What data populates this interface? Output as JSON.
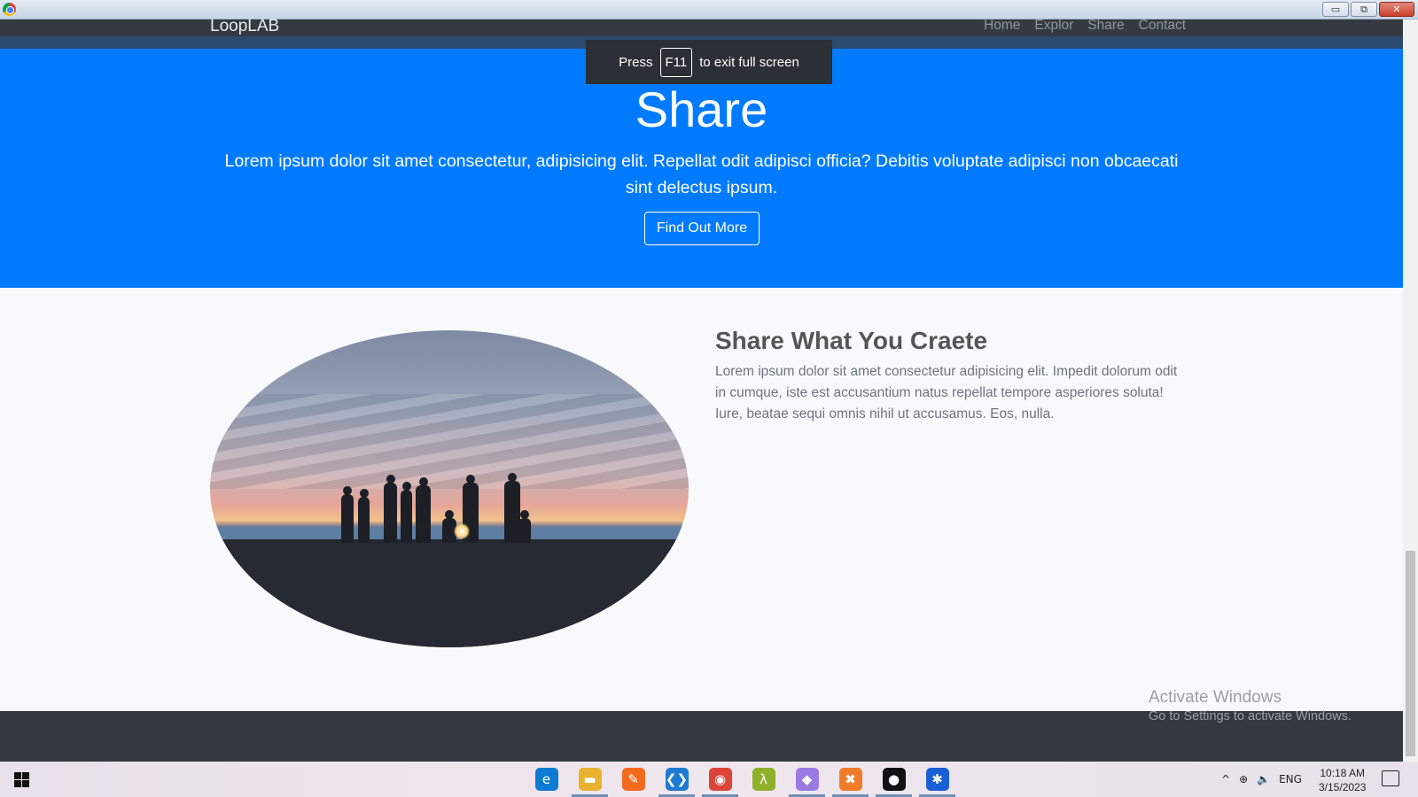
{
  "window": {
    "minimize": "▭",
    "restore": "⧉",
    "close": "✕"
  },
  "navbar": {
    "brand": "LoopLAB",
    "links": [
      "Home",
      "Explor",
      "Share",
      "Contact"
    ]
  },
  "fullscreen_notice": {
    "prefix": "Press",
    "key": "F11",
    "suffix": "to exit full screen"
  },
  "hero": {
    "title": "Share",
    "text": "Lorem ipsum dolor sit amet consectetur, adipisicing elit. Repellat odit adipisci officia? Debitis voluptate adipisci non obcaecati sint delectus ipsum.",
    "button": "Find Out More",
    "background": "#007bff"
  },
  "feature": {
    "heading": "Share What You Craete",
    "text": "Lorem ipsum dolor sit amet consectetur adipisicing elit. Impedit dolorum odit in cumque, iste est accusantium natus repellat tempore asperiores soluta! Iure, beatae sequi omnis nihil ut accusamus. Eos, nulla."
  },
  "watermark": {
    "line1": "Activate Windows",
    "line2": "Go to Settings to activate Windows."
  },
  "taskbar": {
    "apps": [
      {
        "name": "edge-icon",
        "glyph": "e",
        "color": "#0c7bd1",
        "active": false
      },
      {
        "name": "file-explorer-icon",
        "glyph": "▬",
        "color": "#e8b230",
        "active": true
      },
      {
        "name": "brush-app-icon",
        "glyph": "✎",
        "color": "#f26b1d",
        "active": false
      },
      {
        "name": "vscode-icon",
        "glyph": "❮❯",
        "color": "#1f7ad1",
        "active": true
      },
      {
        "name": "chrome-icon",
        "glyph": "◉",
        "color": "#db4437",
        "active": true
      },
      {
        "name": "lambda-app-icon",
        "glyph": "λ",
        "color": "#8fb02a",
        "active": false
      },
      {
        "name": "git-app-icon",
        "glyph": "◆",
        "color": "#9b7be3",
        "active": true
      },
      {
        "name": "xampp-icon",
        "glyph": "✖",
        "color": "#f07c2a",
        "active": true
      },
      {
        "name": "recorder-icon",
        "glyph": "●",
        "color": "#111111",
        "active": true
      },
      {
        "name": "app-settings-icon",
        "glyph": "✱",
        "color": "#1a5fd6",
        "active": true
      }
    ],
    "tray": {
      "chevron": "^",
      "globe": "⊕",
      "volume": "🔈",
      "language": "ENG"
    },
    "time": "10:18 AM",
    "date": "3/15/2023"
  }
}
